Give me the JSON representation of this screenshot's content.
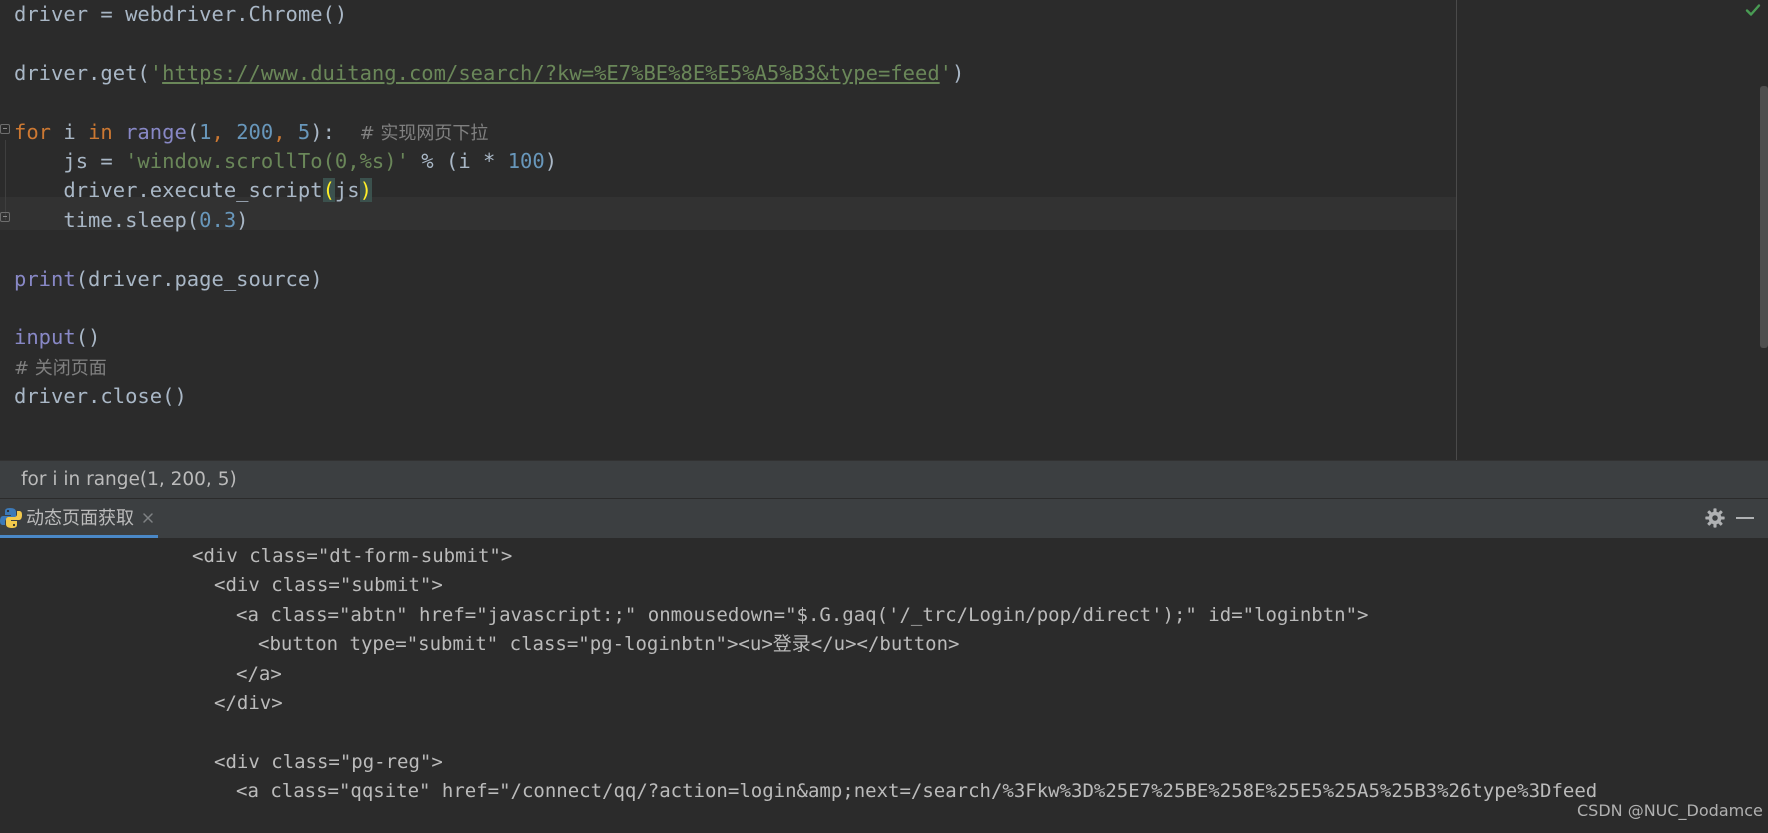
{
  "editor": {
    "lines": [
      [
        {
          "t": "driver = webdriver.Chrome()",
          "c": ""
        }
      ],
      [],
      [
        {
          "t": "driver.get(",
          "c": ""
        },
        {
          "t": "'",
          "c": "str"
        },
        {
          "t": "https://www.duitang.com/search/?kw=%E7%BE%8E%E5%A5%B3&type=feed",
          "c": "url"
        },
        {
          "t": "'",
          "c": "str"
        },
        {
          "t": ")",
          "c": ""
        }
      ],
      [],
      [
        {
          "t": "for",
          "c": "kw"
        },
        {
          "t": " i ",
          "c": ""
        },
        {
          "t": "in",
          "c": "kw"
        },
        {
          "t": " ",
          "c": ""
        },
        {
          "t": "range",
          "c": "bi"
        },
        {
          "t": "(",
          "c": ""
        },
        {
          "t": "1",
          "c": "num"
        },
        {
          "t": ", ",
          "c": "kw"
        },
        {
          "t": "200",
          "c": "num"
        },
        {
          "t": ", ",
          "c": "kw"
        },
        {
          "t": "5",
          "c": "num"
        },
        {
          "t": "):  ",
          "c": ""
        },
        {
          "t": "# 实现网页下拉",
          "c": "com"
        }
      ],
      [
        {
          "t": "    js = ",
          "c": ""
        },
        {
          "t": "'window.scrollTo(0,%s)'",
          "c": "str"
        },
        {
          "t": " % (i * ",
          "c": ""
        },
        {
          "t": "100",
          "c": "num"
        },
        {
          "t": ")",
          "c": ""
        }
      ],
      [
        {
          "t": "    driver.execute_script",
          "c": ""
        },
        {
          "t": "(",
          "c": "brace"
        },
        {
          "t": "js",
          "c": ""
        },
        {
          "t": ")",
          "c": "brace"
        }
      ],
      [
        {
          "t": "    time.sleep(",
          "c": ""
        },
        {
          "t": "0.3",
          "c": "num"
        },
        {
          "t": ")",
          "c": ""
        }
      ],
      [],
      [
        {
          "t": "print",
          "c": "bi"
        },
        {
          "t": "(driver.page_source)",
          "c": ""
        }
      ],
      [],
      [
        {
          "t": "input",
          "c": "bi"
        },
        {
          "t": "()",
          "c": ""
        }
      ],
      [
        {
          "t": "# 关闭页面",
          "c": "com"
        }
      ],
      [
        {
          "t": "driver.close()",
          "c": ""
        }
      ]
    ]
  },
  "breadcrumb": {
    "text": "for i in range(1, 200, 5)"
  },
  "run_panel": {
    "tab_label": "动态页面获取",
    "output_lines": [
      {
        "indent": 0,
        "text": "<div class=\"dt-form-submit\">"
      },
      {
        "indent": 1,
        "text": "<div class=\"submit\">"
      },
      {
        "indent": 2,
        "text": "<a class=\"abtn\" href=\"javascript:;\" onmousedown=\"$.G.gaq('/_trc/Login/pop/direct');\" id=\"loginbtn\">"
      },
      {
        "indent": 3,
        "text": "<button type=\"submit\" class=\"pg-loginbtn\"><u>登录</u></button>"
      },
      {
        "indent": 2,
        "text": "</a>"
      },
      {
        "indent": 1,
        "text": "</div>"
      },
      {
        "indent": 0,
        "text": ""
      },
      {
        "indent": 1,
        "text": "<div class=\"pg-reg\">"
      },
      {
        "indent": 2,
        "text": "<a class=\"qqsite\" href=\"/connect/qq/?action=login&amp;next=/search/%3Fkw%3D%25E7%25BE%258E%25E5%25A5%25B3%26type%3Dfeed"
      }
    ]
  },
  "watermark": "CSDN @NUC_Dodamce",
  "icons": {
    "inspection": "check-icon",
    "tab": "python-icon",
    "tab_close": "close-icon",
    "settings": "gear-icon",
    "hide": "minimize-icon"
  },
  "colors": {
    "editor_bg": "#2b2b2b",
    "keyword": "#cc7832",
    "string": "#6a8759",
    "number": "#6897bb",
    "builtin": "#8888c6",
    "comment": "#808080",
    "text": "#a9b7c6",
    "accent": "#4a88c7"
  }
}
